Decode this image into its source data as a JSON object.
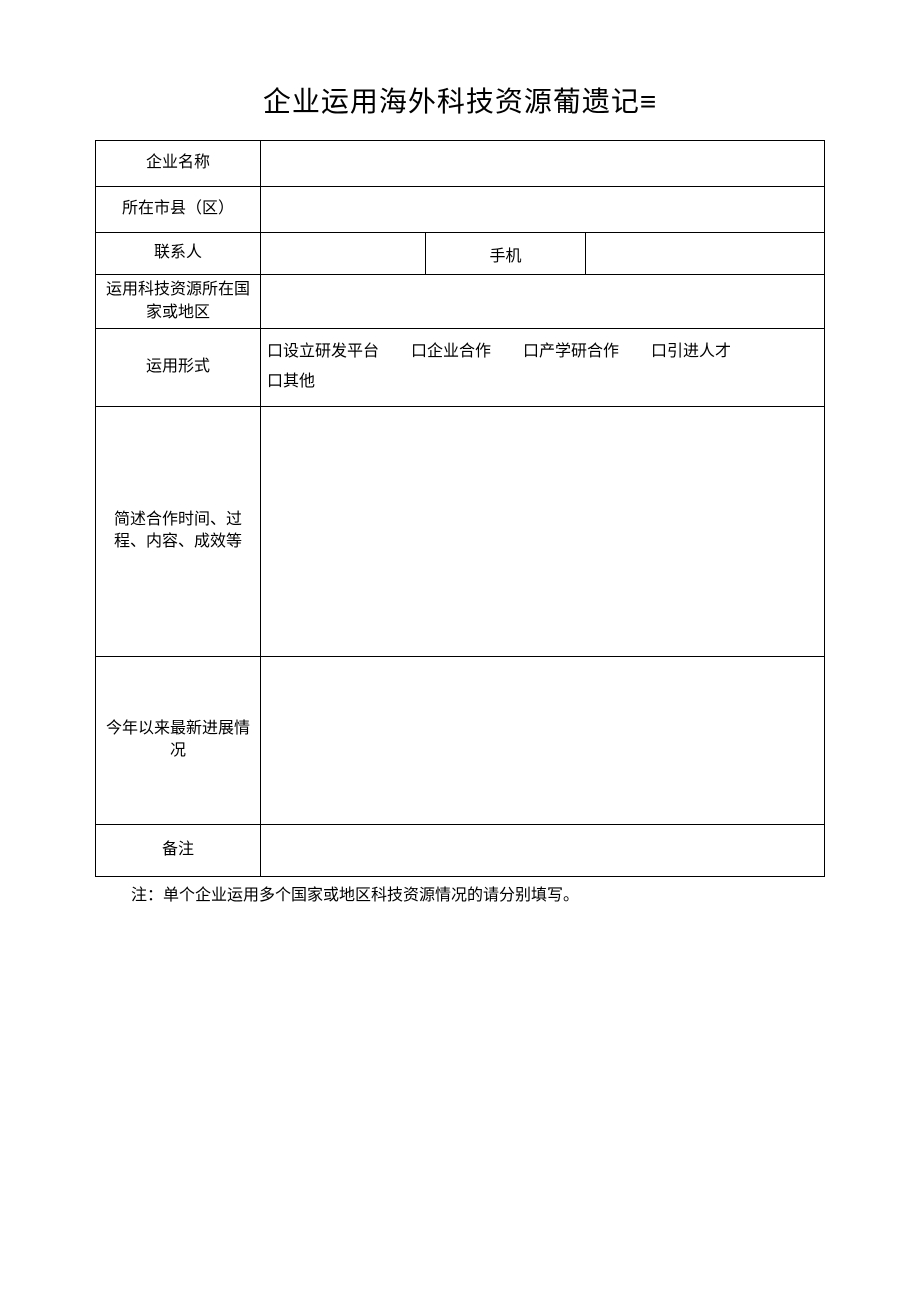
{
  "title": "企业运用海外科技资源葡遗记≡",
  "rows": {
    "company_name": {
      "label": "企业名称",
      "value": ""
    },
    "city_county": {
      "label": "所在市县（区）",
      "value": ""
    },
    "contact": {
      "label": "联系人",
      "value": "",
      "phone_label": "手机",
      "phone_value": ""
    },
    "resource_country": {
      "label": "运用科技资源所在国家或地区",
      "value": ""
    },
    "form": {
      "label": "运用形式",
      "options": {
        "opt1": "口设立研发平台",
        "opt2": "口企业合作",
        "opt3": "口产学研合作",
        "opt4": "口引进人才",
        "opt5": "口其他"
      }
    },
    "summary": {
      "label": "简述合作时间、过程、内容、成效等",
      "value": ""
    },
    "progress": {
      "label": "今年以来最新进展情况",
      "value": ""
    },
    "remark": {
      "label": "备注",
      "value": ""
    }
  },
  "note": "注：单个企业运用多个国家或地区科技资源情况的请分别填写。"
}
